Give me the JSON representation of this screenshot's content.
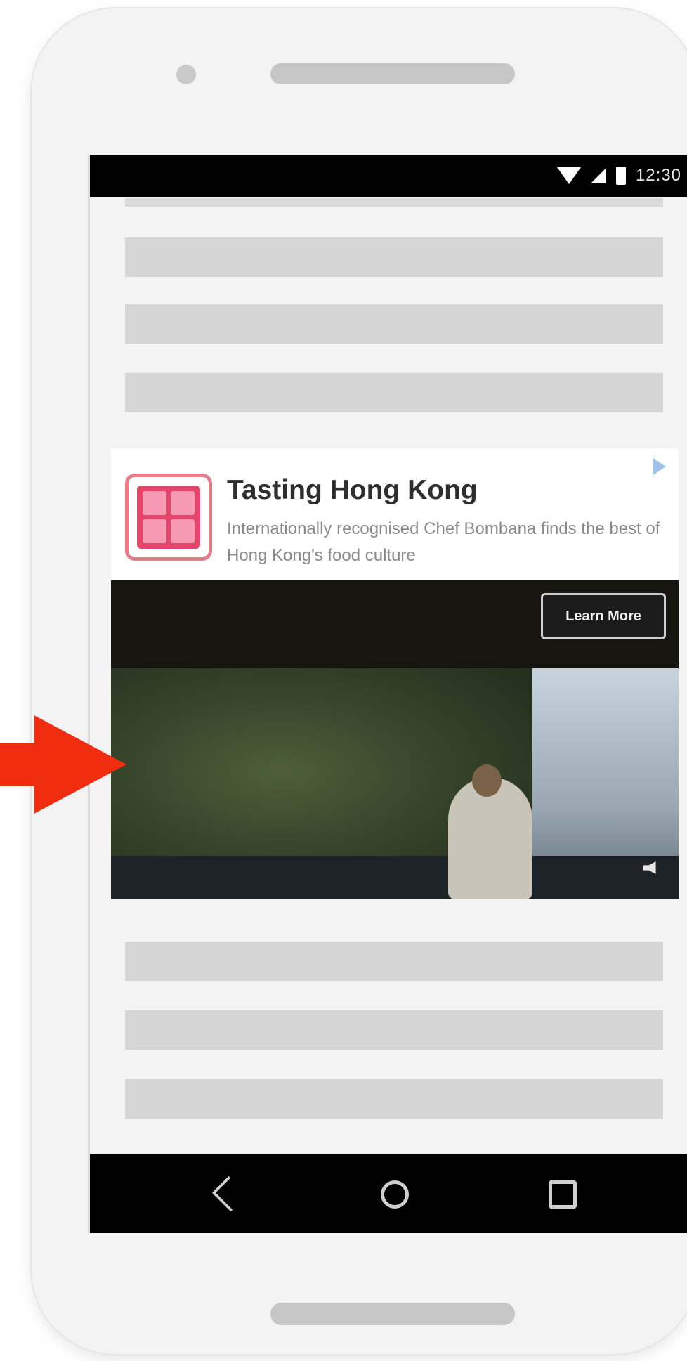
{
  "status_bar": {
    "time": "12:30"
  },
  "ad": {
    "title": "Tasting Hong Kong",
    "description": "Internationally recognised Chef Bombana finds the best of Hong Kong's food culture",
    "cta_label": "Learn More"
  },
  "nav_bar": {
    "back_icon": "back-triangle-icon",
    "home_icon": "home-circle-icon",
    "recents_icon": "recents-square-icon"
  },
  "colors": {
    "arrow": "#f12d0f",
    "placeholder": "#d6d6d6",
    "bars": "#000000"
  }
}
